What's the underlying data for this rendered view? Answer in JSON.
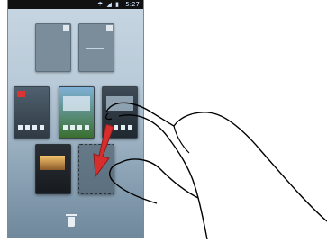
{
  "status_bar": {
    "icons": "☂ ◢ ▮",
    "time": "5:27"
  },
  "colors": {
    "arrow": "#d62d2d",
    "screen_bg": "#b9cad8"
  },
  "icons": {
    "delete": "trash-icon",
    "gesture": "hand-icon",
    "direction": "arrow-down-icon"
  }
}
